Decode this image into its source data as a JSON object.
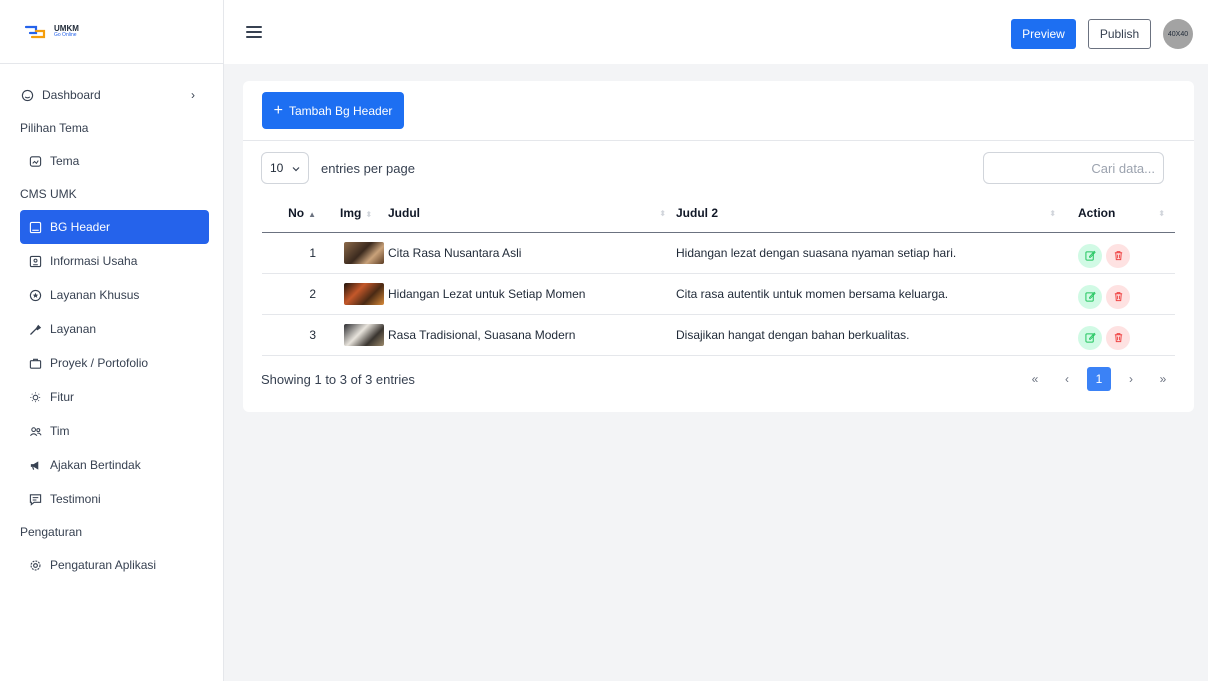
{
  "app": {
    "logo_text": "UMKM",
    "logo_subtext": "Go Online"
  },
  "sidebar": {
    "dashboard": "Dashboard",
    "sections": [
      {
        "title": "Pilihan Tema",
        "items": [
          "Tema"
        ]
      },
      {
        "title": "CMS UMK",
        "items": [
          "BG Header",
          "Informasi Usaha",
          "Layanan Khusus",
          "Layanan",
          "Proyek / Portofolio",
          "Fitur",
          "Tim",
          "Ajakan Bertindak",
          "Testimoni"
        ]
      },
      {
        "title": "Pengaturan",
        "items": [
          "Pengaturan Aplikasi"
        ]
      }
    ],
    "active_item": "BG Header"
  },
  "topbar": {
    "preview_label": "Preview",
    "publish_label": "Publish",
    "avatar_text": "40X40"
  },
  "card": {
    "add_button_label": "Tambah Bg Header",
    "entries_value": "10",
    "entries_label": "entries per page",
    "search_placeholder": "Cari data...",
    "columns": [
      "No",
      "Img",
      "Judul",
      "Judul 2",
      "Action"
    ],
    "rows": [
      {
        "no": "1",
        "judul": "Cita Rasa Nusantara Asli",
        "judul2": "Hidangan lezat dengan suasana nyaman setiap hari."
      },
      {
        "no": "2",
        "judul": "Hidangan Lezat untuk Setiap Momen",
        "judul2": "Cita rasa autentik untuk momen bersama keluarga."
      },
      {
        "no": "3",
        "judul": "Rasa Tradisional, Suasana Modern",
        "judul2": "Disajikan hangat dengan bahan berkualitas."
      }
    ],
    "showing_text": "Showing 1 to 3 of 3 entries",
    "pagination": {
      "first": "«",
      "prev": "‹",
      "current": "1",
      "next": "›",
      "last": "»"
    }
  },
  "colors": {
    "primary": "#1d6ff2",
    "active_nav": "#2563eb",
    "edit_bg": "#d1fae5",
    "delete_bg": "#fee2e2"
  }
}
